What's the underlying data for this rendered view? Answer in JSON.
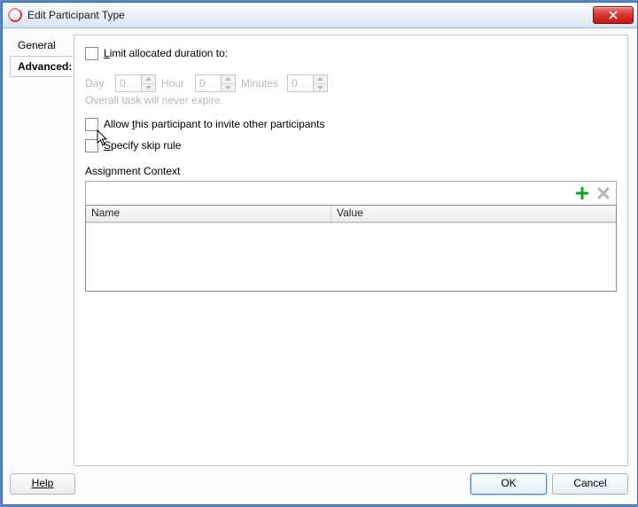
{
  "window": {
    "title": "Edit Participant Type"
  },
  "tabs": {
    "general": "General",
    "advanced": "Advanced:"
  },
  "limit": {
    "label_pre": "L",
    "label_post": "imit allocated duration to:",
    "day_label": "Day",
    "day_value": "0",
    "hour_label": "Hour",
    "hour_value": "0",
    "minutes_label": "Minutes",
    "minutes_value": "0",
    "hint": "Overall task will never expire."
  },
  "invite": {
    "pre": "Allow ",
    "u": "t",
    "post": "his participant to invite other participants"
  },
  "skip": {
    "u": "S",
    "post": "pecify skip rule"
  },
  "assignment": {
    "label": "Assignment Context",
    "col_name": "Name",
    "col_value": "Value"
  },
  "buttons": {
    "help": "H",
    "help_post": "elp",
    "ok": "OK",
    "cancel": "Cancel"
  }
}
